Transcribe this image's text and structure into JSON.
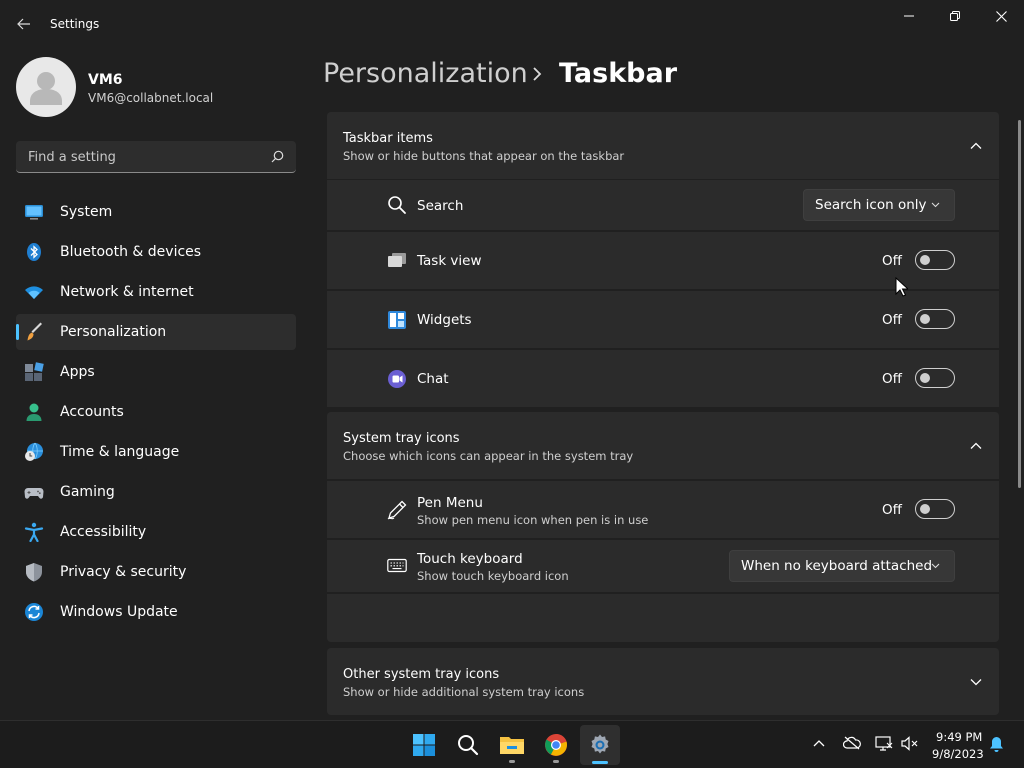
{
  "window": {
    "title": "Settings"
  },
  "user": {
    "name": "VM6",
    "email": "VM6@collabnet.local"
  },
  "search": {
    "placeholder": "Find a setting"
  },
  "sidebar": {
    "items": [
      {
        "label": "System",
        "icon": "system-icon"
      },
      {
        "label": "Bluetooth & devices",
        "icon": "bluetooth-icon"
      },
      {
        "label": "Network & internet",
        "icon": "wifi-icon"
      },
      {
        "label": "Personalization",
        "icon": "brush-icon",
        "selected": true
      },
      {
        "label": "Apps",
        "icon": "apps-icon"
      },
      {
        "label": "Accounts",
        "icon": "person-icon"
      },
      {
        "label": "Time & language",
        "icon": "globe-clock-icon"
      },
      {
        "label": "Gaming",
        "icon": "gamepad-icon"
      },
      {
        "label": "Accessibility",
        "icon": "accessibility-icon"
      },
      {
        "label": "Privacy & security",
        "icon": "shield-icon"
      },
      {
        "label": "Windows Update",
        "icon": "update-icon"
      }
    ]
  },
  "breadcrumb": {
    "parent": "Personalization",
    "current": "Taskbar"
  },
  "taskbar_items": {
    "title": "Taskbar items",
    "subtitle": "Show or hide buttons that appear on the taskbar",
    "rows": {
      "search": {
        "label": "Search",
        "value": "Search icon only",
        "icon": "search-icon"
      },
      "task_view": {
        "label": "Task view",
        "state": "Off",
        "on": false,
        "icon": "task-view-icon"
      },
      "widgets": {
        "label": "Widgets",
        "state": "Off",
        "on": false,
        "icon": "widgets-icon"
      },
      "chat": {
        "label": "Chat",
        "state": "Off",
        "on": false,
        "icon": "chat-icon"
      }
    }
  },
  "system_tray": {
    "title": "System tray icons",
    "subtitle": "Choose which icons can appear in the system tray",
    "rows": {
      "pen_menu": {
        "label": "Pen Menu",
        "sub": "Show pen menu icon when pen is in use",
        "state": "Off",
        "on": false,
        "icon": "pen-icon"
      },
      "touch_keyboard": {
        "label": "Touch keyboard",
        "sub": "Show touch keyboard icon",
        "value": "When no keyboard attached",
        "icon": "keyboard-icon"
      }
    }
  },
  "other_tray": {
    "title": "Other system tray icons",
    "subtitle": "Show or hide additional system tray icons"
  },
  "taskbar": {
    "apps": [
      "start-icon",
      "search-icon",
      "file-explorer-icon",
      "chrome-icon",
      "settings-icon"
    ],
    "time": "9:49 PM",
    "date": "9/8/2023"
  },
  "colors": {
    "accent": "#4cc2ff",
    "background": "#202020",
    "card": "#2b2b2b"
  }
}
